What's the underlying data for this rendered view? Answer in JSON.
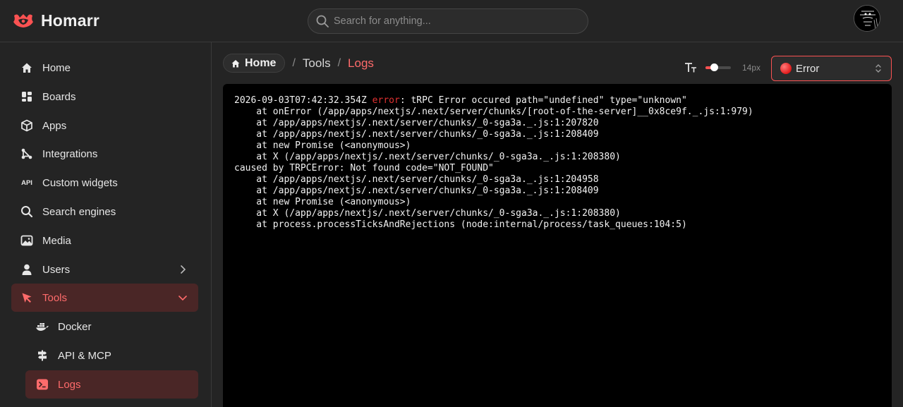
{
  "app": {
    "name": "Homarr"
  },
  "search": {
    "placeholder": "Search for anything..."
  },
  "sidebar": {
    "items": [
      {
        "label": "Home",
        "icon": "home-icon"
      },
      {
        "label": "Boards",
        "icon": "layout-icon"
      },
      {
        "label": "Apps",
        "icon": "box-icon"
      },
      {
        "label": "Integrations",
        "icon": "plug-icon"
      },
      {
        "label": "Custom widgets",
        "icon": "api-icon"
      },
      {
        "label": "Search engines",
        "icon": "search-icon"
      },
      {
        "label": "Media",
        "icon": "photo-icon"
      },
      {
        "label": "Users",
        "icon": "user-icon"
      },
      {
        "label": "Tools",
        "icon": "pointer-icon"
      },
      {
        "label": "Docker",
        "icon": "docker-icon"
      },
      {
        "label": "API & MCP",
        "icon": "signpost-icon"
      },
      {
        "label": "Logs",
        "icon": "terminal-icon"
      }
    ],
    "api_badge": "API"
  },
  "breadcrumb": {
    "home": "Home",
    "tools": "Tools",
    "current": "Logs",
    "separator": "/"
  },
  "font_control": {
    "size_label": "14px",
    "level": 0.35
  },
  "level_select": {
    "value": "Error"
  },
  "log": {
    "lines": [
      {
        "ts": "2026-09-03T07:42:32.354Z ",
        "level": "error",
        "rest": ": tRPC Error occured path=\"undefined\" type=\"unknown\""
      },
      {
        "text": "    at onError (/app/apps/nextjs/.next/server/chunks/[root-of-the-server]__0x8ce9f._.js:1:979)"
      },
      {
        "text": "    at /app/apps/nextjs/.next/server/chunks/_0-sga3a._.js:1:207820"
      },
      {
        "text": "    at /app/apps/nextjs/.next/server/chunks/_0-sga3a._.js:1:208409"
      },
      {
        "text": "    at new Promise (<anonymous>)"
      },
      {
        "text": "    at X (/app/apps/nextjs/.next/server/chunks/_0-sga3a._.js:1:208380)"
      },
      {
        "text": "caused by TRPCError: Not found code=\"NOT_FOUND\""
      },
      {
        "text": "    at /app/apps/nextjs/.next/server/chunks/_0-sga3a._.js:1:204958"
      },
      {
        "text": "    at /app/apps/nextjs/.next/server/chunks/_0-sga3a._.js:1:208409"
      },
      {
        "text": "    at new Promise (<anonymous>)"
      },
      {
        "text": "    at X (/app/apps/nextjs/.next/server/chunks/_0-sga3a._.js:1:208380)"
      },
      {
        "text": "    at process.processTicksAndRejections (node:internal/process/task_queues:104:5)"
      }
    ]
  },
  "colors": {
    "accent": "#fa5252",
    "active_bg": "#4a2626",
    "background": "#242424",
    "console": "#000000"
  }
}
